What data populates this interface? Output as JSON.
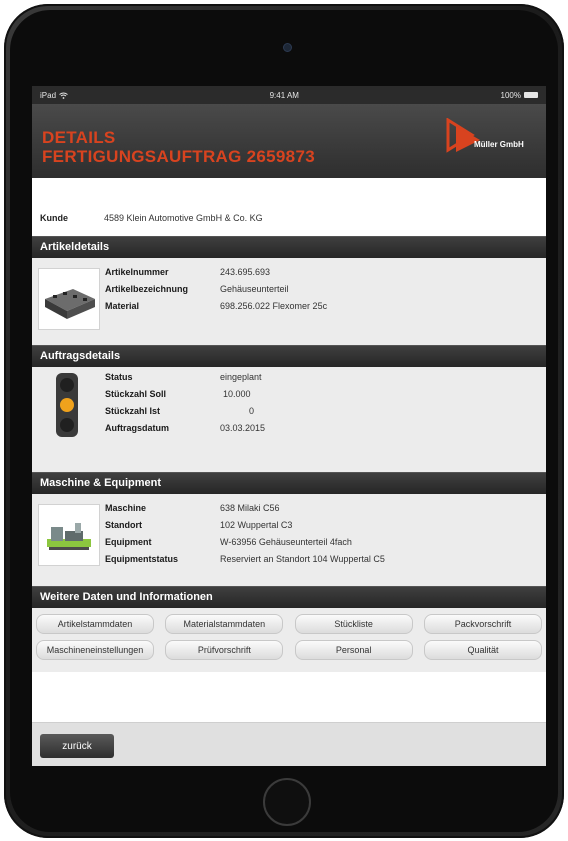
{
  "status_bar": {
    "device": "iPad",
    "wifi_icon": "wifi-icon",
    "time": "9:41 AM",
    "battery": "100%"
  },
  "header": {
    "line1": "DETAILS",
    "line2": "FERTIGUNGSAUFTRAG 2659873",
    "company": "Müller GmbH",
    "accent_color": "#d8431f"
  },
  "customer": {
    "label": "Kunde",
    "value": "4589 Klein Automotive GmbH & Co. KG"
  },
  "article": {
    "title": "Artikeldetails",
    "fields": [
      {
        "label": "Artikelnummer",
        "value": "243.695.693"
      },
      {
        "label": "Artikelbezeichnung",
        "value": "Gehäuseunterteil"
      },
      {
        "label": "Material",
        "value": "698.256.022 Flexomer 25c"
      }
    ]
  },
  "order": {
    "title": "Auftragsdetails",
    "traffic_light": "amber",
    "fields": [
      {
        "label": "Status",
        "value": "eingeplant"
      },
      {
        "label": "Stückzahl Soll",
        "value": "10.000"
      },
      {
        "label": "Stückzahl Ist",
        "value": "0"
      },
      {
        "label": "Auftragsdatum",
        "value": "03.03.2015"
      }
    ]
  },
  "machine": {
    "title": "Maschine & Equipment",
    "fields": [
      {
        "label": "Maschine",
        "value": "638 Milaki C56"
      },
      {
        "label": "Standort",
        "value": "102 Wuppertal C3"
      },
      {
        "label": "Equipment",
        "value": "W-63956 Gehäuseunterteil 4fach"
      },
      {
        "label": "Equipmentstatus",
        "value": "Reserviert an Standort 104 Wuppertal C5"
      }
    ]
  },
  "more": {
    "title": "Weitere Daten und Informationen",
    "buttons": [
      "Artikelstammdaten",
      "Materialstammdaten",
      "Stückliste",
      "Packvorschrift",
      "Maschineneinstellungen",
      "Prüfvorschrift",
      "Personal",
      "Qualität"
    ]
  },
  "footer": {
    "back": "zurück"
  }
}
